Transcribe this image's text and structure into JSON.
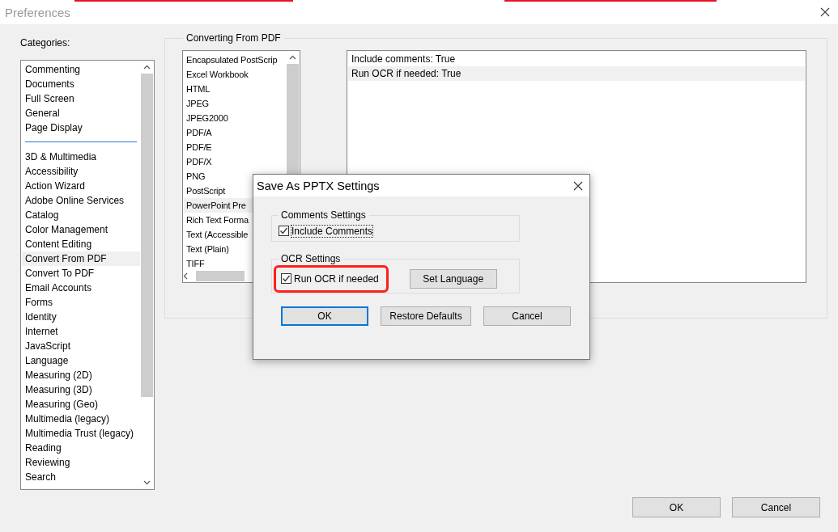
{
  "window": {
    "title": "Preferences"
  },
  "categories": {
    "label": "Categories:",
    "groups": [
      {
        "items": [
          {
            "label": "Commenting",
            "selected": false
          },
          {
            "label": "Documents",
            "selected": false
          },
          {
            "label": "Full Screen",
            "selected": false
          },
          {
            "label": "General",
            "selected": false
          },
          {
            "label": "Page Display",
            "selected": false
          }
        ]
      },
      {
        "items": [
          {
            "label": "3D & Multimedia",
            "selected": false
          },
          {
            "label": "Accessibility",
            "selected": false
          },
          {
            "label": "Action Wizard",
            "selected": false
          },
          {
            "label": "Adobe Online Services",
            "selected": false
          },
          {
            "label": "Catalog",
            "selected": false
          },
          {
            "label": "Color Management",
            "selected": false
          },
          {
            "label": "Content Editing",
            "selected": false
          },
          {
            "label": "Convert From PDF",
            "selected": true
          },
          {
            "label": "Convert To PDF",
            "selected": false
          },
          {
            "label": "Email Accounts",
            "selected": false
          },
          {
            "label": "Forms",
            "selected": false
          },
          {
            "label": "Identity",
            "selected": false
          },
          {
            "label": "Internet",
            "selected": false
          },
          {
            "label": "JavaScript",
            "selected": false
          },
          {
            "label": "Language",
            "selected": false
          },
          {
            "label": "Measuring (2D)",
            "selected": false
          },
          {
            "label": "Measuring (3D)",
            "selected": false
          },
          {
            "label": "Measuring (Geo)",
            "selected": false
          },
          {
            "label": "Multimedia (legacy)",
            "selected": false
          },
          {
            "label": "Multimedia Trust (legacy)",
            "selected": false
          },
          {
            "label": "Reading",
            "selected": false
          },
          {
            "label": "Reviewing",
            "selected": false
          },
          {
            "label": "Search",
            "selected": false
          }
        ]
      }
    ]
  },
  "converting_from_pdf": {
    "title": "Converting From PDF",
    "formats": [
      {
        "label": "Encapsulated PostScrip",
        "selected": false
      },
      {
        "label": "Excel Workbook",
        "selected": false
      },
      {
        "label": "HTML",
        "selected": false
      },
      {
        "label": "JPEG",
        "selected": false
      },
      {
        "label": "JPEG2000",
        "selected": false
      },
      {
        "label": "PDF/A",
        "selected": false
      },
      {
        "label": "PDF/E",
        "selected": false
      },
      {
        "label": "PDF/X",
        "selected": false
      },
      {
        "label": "PNG",
        "selected": false
      },
      {
        "label": "PostScript",
        "selected": false
      },
      {
        "label": "PowerPoint Pre",
        "selected": true
      },
      {
        "label": "Rich Text Forma",
        "selected": false
      },
      {
        "label": "Text (Accessible",
        "selected": false
      },
      {
        "label": "Text (Plain)",
        "selected": false
      },
      {
        "label": "TIFF",
        "selected": false
      }
    ],
    "settings": [
      {
        "text": "Include comments: True",
        "selected": false
      },
      {
        "text": "Run OCR if needed: True",
        "selected": true
      }
    ]
  },
  "dialog": {
    "title": "Save As PPTX Settings",
    "groups": [
      {
        "title": "Comments Settings",
        "checkbox": {
          "label": "Include Comments",
          "checked": true,
          "focused": true
        }
      },
      {
        "title": "OCR Settings",
        "checkbox": {
          "label": "Run OCR if needed",
          "checked": true,
          "focused": false,
          "highlighted": true
        },
        "button": "Set Language"
      }
    ],
    "buttons": [
      {
        "label": "OK",
        "default": true
      },
      {
        "label": "Restore Defaults",
        "default": false
      },
      {
        "label": "Cancel",
        "default": false
      }
    ]
  },
  "buttons": [
    {
      "label": "OK"
    },
    {
      "label": "Cancel"
    }
  ]
}
